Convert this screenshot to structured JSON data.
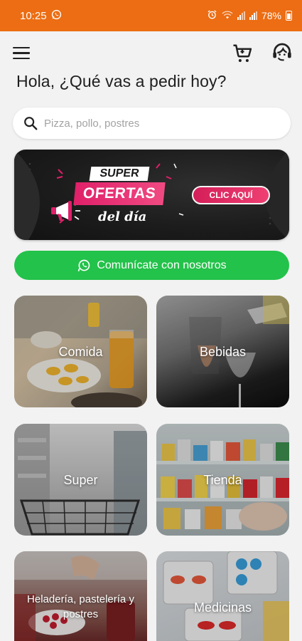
{
  "status_bar": {
    "time": "10:25",
    "battery": "78%"
  },
  "header": {
    "greeting": "Hola, ¿Qué vas a pedir hoy?"
  },
  "search": {
    "placeholder": "Pizza, pollo, postres"
  },
  "banner": {
    "line1": "SUPER",
    "line2": "OFERTAS",
    "line3": "del día",
    "cta": "CLIC AQUÍ"
  },
  "whatsapp": {
    "label": "Comunícate con nosotros"
  },
  "categories": [
    {
      "label": "Comida"
    },
    {
      "label": "Bebidas"
    },
    {
      "label": "Super"
    },
    {
      "label": "Tienda"
    },
    {
      "label": "Heladería, pastelería y postres"
    },
    {
      "label": "Medicinas"
    }
  ],
  "colors": {
    "status_bar": "#ec6d13",
    "whatsapp_green": "#23c24a",
    "promo_pink": "#e0206a"
  }
}
